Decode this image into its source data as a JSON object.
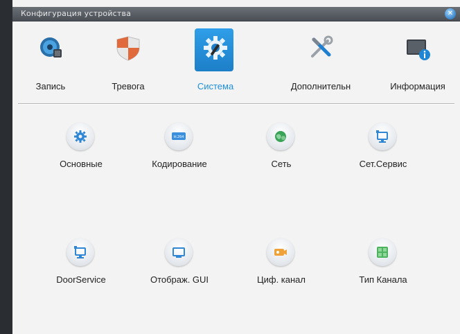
{
  "window": {
    "title": "Конфигурация устройства"
  },
  "tabs": [
    {
      "label": "Запись",
      "icon": "record-disk-icon",
      "active": false
    },
    {
      "label": "Тревога",
      "icon": "alarm-shield-icon",
      "active": false
    },
    {
      "label": "Система",
      "icon": "system-gear-icon",
      "active": true
    },
    {
      "label": "Дополнительн",
      "icon": "tools-icon",
      "active": false
    },
    {
      "label": "Информация",
      "icon": "info-monitor-icon",
      "active": false
    }
  ],
  "items": [
    {
      "label": "Основные",
      "icon": "gear-icon"
    },
    {
      "label": "Кодирование",
      "icon": "h264-icon",
      "icon_text": "H.264"
    },
    {
      "label": "Сеть",
      "icon": "network-globe-icon"
    },
    {
      "label": "Сет.Сервис",
      "icon": "network-service-icon"
    },
    {
      "label": "DoorService",
      "icon": "door-service-icon"
    },
    {
      "label": "Отображ. GUI",
      "icon": "display-gui-icon"
    },
    {
      "label": "Циф. канал",
      "icon": "digital-channel-camera-icon"
    },
    {
      "label": "Тип Канала",
      "icon": "channel-type-icon"
    }
  ],
  "colors": {
    "accent": "#1e8fd9",
    "title_bar": "#5a5f66",
    "background": "#f3f3f3"
  }
}
